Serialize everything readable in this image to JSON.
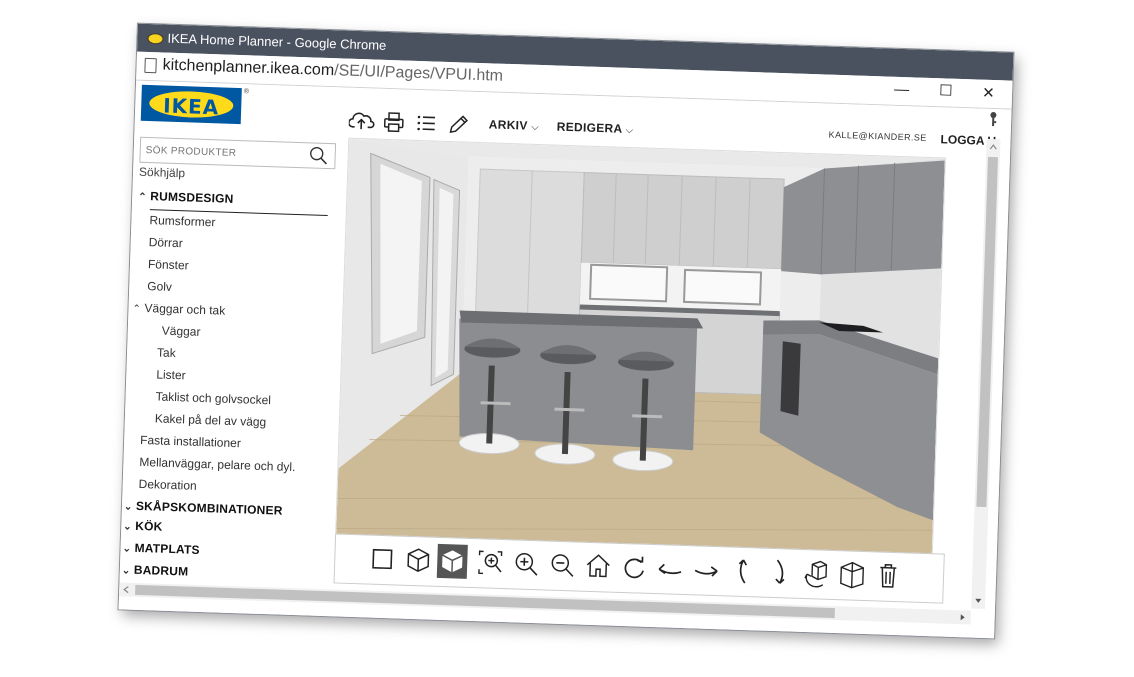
{
  "window": {
    "title": "IKEA Home Planner - Google Chrome",
    "minimize_glyph": "—",
    "maximize_glyph": "☐",
    "close_glyph": "✕"
  },
  "address_bar": {
    "url_host": "kitchenplanner.ikea.com",
    "url_path": "/SE/UI/Pages/VPUI.htm"
  },
  "logo": {
    "text": "IKEA",
    "reg": "®"
  },
  "toolbar": {
    "icons": [
      "cloud-upload-icon",
      "print-icon",
      "list-icon",
      "pencil-icon"
    ],
    "menu_arkiv": "ARKIV",
    "menu_redigera": "REDIGERA",
    "user_email": "KALLE@KIANDER.SE",
    "logout_label": "LOGGA U"
  },
  "sidebar": {
    "search_placeholder": "SÖK PRODUKTER",
    "search_help": "Sökhjälp",
    "section_rumsdesign": "RUMSDESIGN",
    "items": {
      "rumsformer": "Rumsformer",
      "dorrar": "Dörrar",
      "fonster": "Fönster",
      "golv": "Golv",
      "vaggar_och_tak": "Väggar och tak",
      "vaggar": "Väggar",
      "tak": "Tak",
      "lister": "Lister",
      "taklist": "Taklist och golvsockel",
      "kakel": "Kakel på del av vägg",
      "fasta": "Fasta installationer",
      "mellanvaggar": "Mellanväggar, pelare och dyl.",
      "dekoration": "Dekoration"
    },
    "sections": {
      "skapskombinationer": "SKÅPSKOMBINATIONER",
      "kok": "KÖK",
      "matplats": "MATPLATS",
      "badrum": "BADRUM"
    }
  },
  "view_toolbar": {
    "buttons": [
      "2d-view-icon",
      "3d-view-icon",
      "3d-solid-view-icon",
      "zoom-fit-icon",
      "zoom-in-icon",
      "zoom-out-icon",
      "home-view-icon",
      "rotate-right-icon",
      "pan-left-icon",
      "pan-right-icon",
      "tilt-up-icon",
      "tilt-down-icon",
      "rotate-object-icon",
      "walls-view-icon",
      "delete-icon"
    ],
    "selected": "3d-solid-view-icon"
  },
  "colors": {
    "titlebar": "#4a5260",
    "ikea_blue": "#0058a3",
    "ikea_yellow": "#ffda1a",
    "cabinet_gray": "#8e8f92",
    "floor_wood": "#cdbb98"
  }
}
